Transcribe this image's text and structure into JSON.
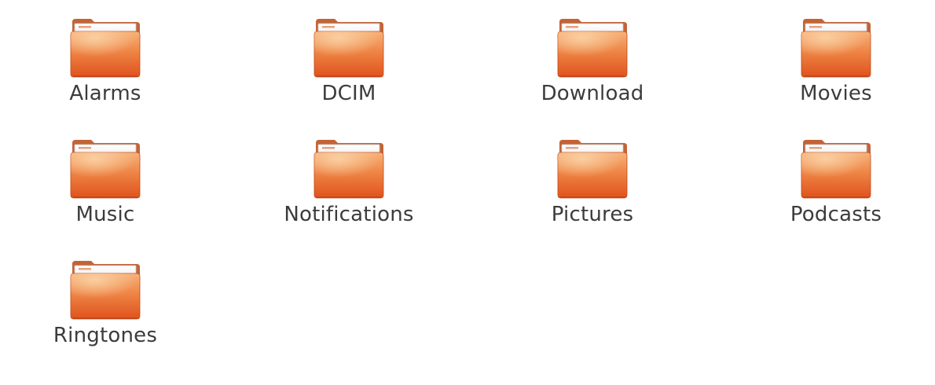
{
  "file_browser": {
    "folders": [
      {
        "name": "Alarms",
        "icon": "folder-icon"
      },
      {
        "name": "DCIM",
        "icon": "folder-icon"
      },
      {
        "name": "Download",
        "icon": "folder-icon"
      },
      {
        "name": "Movies",
        "icon": "folder-icon"
      },
      {
        "name": "Music",
        "icon": "folder-icon"
      },
      {
        "name": "Notifications",
        "icon": "folder-icon"
      },
      {
        "name": "Pictures",
        "icon": "folder-icon"
      },
      {
        "name": "Podcasts",
        "icon": "folder-icon"
      },
      {
        "name": "Ringtones",
        "icon": "folder-icon"
      }
    ]
  },
  "colors": {
    "folder_front_light": "#f7c08a",
    "folder_front_dark": "#e4531e",
    "folder_back": "#c7693a",
    "folder_paper": "#f4f4f4",
    "label_text": "#3c3c3c"
  }
}
